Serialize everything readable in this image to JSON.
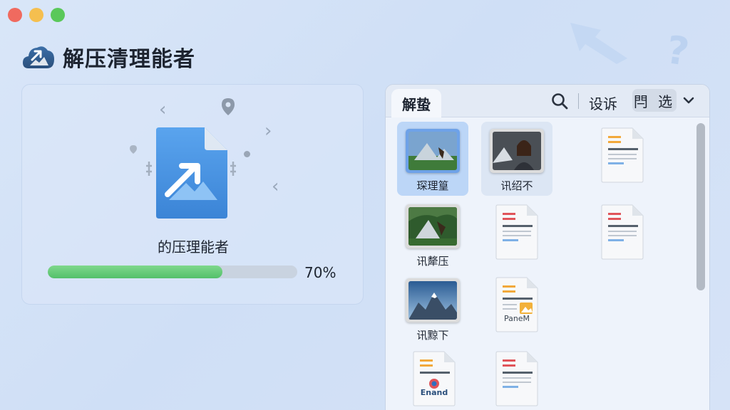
{
  "app": {
    "title": "解压清理能者"
  },
  "progress": {
    "label": "的压理能者",
    "percent_text": "70%",
    "fraction": 0.7
  },
  "browser": {
    "tab_label": "解蛰",
    "toolbar_text": "设诉",
    "toolbar_button": "閂 选"
  },
  "files": [
    {
      "label": "琛理篁",
      "kind": "photo-mountain"
    },
    {
      "label": "讯绍不",
      "kind": "photo-person"
    },
    {
      "label": "讯犛压",
      "kind": "photo-bird"
    },
    {
      "label": "讯黥下",
      "kind": "photo-snow"
    },
    {
      "label": "",
      "kind": "doc-orange"
    },
    {
      "label": "",
      "kind": "doc-red"
    },
    {
      "label": "",
      "kind": "doc-red"
    },
    {
      "label": "PaneM",
      "kind": "doc-image"
    },
    {
      "label": "Enand",
      "kind": "doc-brand"
    },
    {
      "label": "",
      "kind": "doc-red"
    }
  ],
  "colors": {
    "accent": "#53c06a",
    "selection": "#bcd6f7",
    "file_blue": "#3e8ee0"
  },
  "icons": [
    "cloud-logo-icon",
    "search-icon",
    "chevron-down-icon",
    "arrow-left-icon",
    "arrow-right-icon",
    "pin-icon",
    "file-icon",
    "document-icon"
  ]
}
